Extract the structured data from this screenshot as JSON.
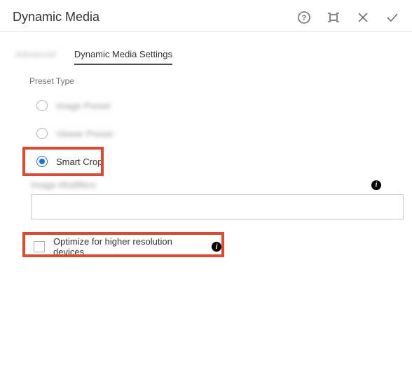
{
  "header": {
    "title": "Dynamic Media"
  },
  "tabs": {
    "tab1": "Advanced",
    "tab2": "Dynamic Media Settings"
  },
  "section": {
    "preset_type_label": "Preset Type",
    "options": {
      "image_preset": "Image Preset",
      "viewer_preset": "Viewer Preset",
      "smart_crop": "Smart Crop"
    },
    "modifiers_label": "Image Modifiers",
    "optimize_label": "Optimize for higher resolution devices"
  }
}
